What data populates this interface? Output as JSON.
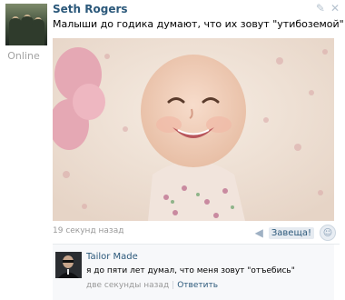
{
  "post": {
    "author": "Seth Rogers",
    "status": "Online",
    "text": "Малыши до годика думают, что их зовут \"утибоземой\"",
    "timestamp": "19 секунд назад",
    "share_label": "Завеща!"
  },
  "comment": {
    "author": "Tailor Made",
    "text": "я до пяти лет думал, что меня зовут \"отъебись\"",
    "timestamp": "две секунды назад",
    "reply_label": "Ответить"
  },
  "icons": {
    "edit": "pencil-icon",
    "close": "close-icon",
    "share": "megaphone-icon",
    "like": "smile-icon"
  },
  "colors": {
    "link": "#2b587a",
    "muted": "#999999",
    "comment_bg": "#f7f8fa"
  }
}
